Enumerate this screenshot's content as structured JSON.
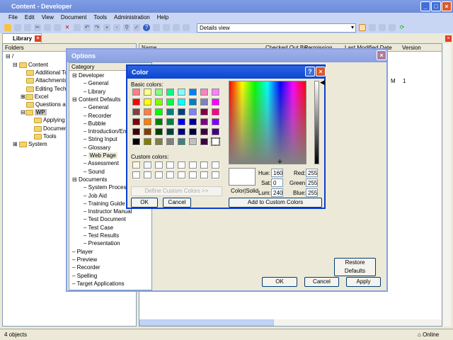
{
  "window": {
    "title": "Content - Developer"
  },
  "menu": [
    "File",
    "Edit",
    "View",
    "Document",
    "Tools",
    "Administration",
    "Help"
  ],
  "toolbar": {
    "view_select": "Details view"
  },
  "tab": {
    "label": "Library"
  },
  "folders": {
    "header": "Folders",
    "items": [
      "/",
      "Content",
      "Additional Top",
      "Attachments",
      "Editing Techni",
      "Excel",
      "Questions and",
      "WP",
      "Applying F",
      "Document",
      "Tools",
      "System"
    ]
  },
  "list": {
    "columns": [
      "Name",
      "Checked Out By",
      "Permission",
      "Last Modified Date",
      "Version"
    ],
    "row": [
      "M",
      "1"
    ]
  },
  "status": {
    "count": "4 objects",
    "online": "Online"
  },
  "options": {
    "title": "Options",
    "category_header": "Category",
    "tree": [
      "Developer",
      "General",
      "Library",
      "Content Defaults",
      "General",
      "Recorder",
      "Bubble",
      "Introduction/End Fr",
      "String Input",
      "Glossary",
      "Web Page",
      "Assessment",
      "Sound",
      "Documents",
      "System Process",
      "Job Aid",
      "Training Guide",
      "Instructor Manual",
      "Test Document",
      "Test Case",
      "Test Results",
      "Presentation",
      "Player",
      "Preview",
      "Recorder",
      "Spelling",
      "Target Applications"
    ],
    "restore": "Restore Defaults",
    "ok": "OK",
    "cancel": "Cancel",
    "apply": "Apply"
  },
  "color": {
    "title": "Color",
    "basic_label": "Basic colors:",
    "custom_label": "Custom colors:",
    "define": "Define Custom Colors >>",
    "ok": "OK",
    "cancel": "Cancel",
    "add": "Add to Custom Colors",
    "solid_label": "Color|Solid",
    "hue_label": "Hue:",
    "hue": "160",
    "sat_label": "Sat:",
    "sat": "0",
    "lum_label": "Lum:",
    "lum": "240",
    "red_label": "Red:",
    "red": "255",
    "green_label": "Green:",
    "green": "255",
    "blue_label": "Blue:",
    "blue": "255",
    "basic": [
      "#FF8080",
      "#FFFF80",
      "#80FF80",
      "#00FF80",
      "#80FFFF",
      "#0080FF",
      "#FF80C0",
      "#FF80FF",
      "#FF0000",
      "#FFFF00",
      "#80FF00",
      "#00FF40",
      "#00FFFF",
      "#0080C0",
      "#8080C0",
      "#FF00FF",
      "#804040",
      "#FF8040",
      "#00FF00",
      "#008080",
      "#004080",
      "#8080FF",
      "#800040",
      "#FF0080",
      "#800000",
      "#FF8000",
      "#008000",
      "#008040",
      "#0000FF",
      "#0000A0",
      "#800080",
      "#8000FF",
      "#400000",
      "#804000",
      "#004000",
      "#004040",
      "#000080",
      "#000040",
      "#400040",
      "#400080",
      "#000000",
      "#808000",
      "#808040",
      "#808080",
      "#408080",
      "#C0C0C0",
      "#400040",
      "#FFFFFF"
    ],
    "custom": [
      "#FFF8DC",
      "#F0F8FF",
      "#FFFFFF",
      "#FFFFFF",
      "#FFFFFF",
      "#FFFFFF",
      "#FFFFFF",
      "#FFFFFF",
      "#FFFFFF",
      "#FFFFFF",
      "#FFFFFF",
      "#FFFFFF",
      "#FFFFFF",
      "#FFFFFF",
      "#FFFFFF",
      "#FFFFFF"
    ]
  }
}
